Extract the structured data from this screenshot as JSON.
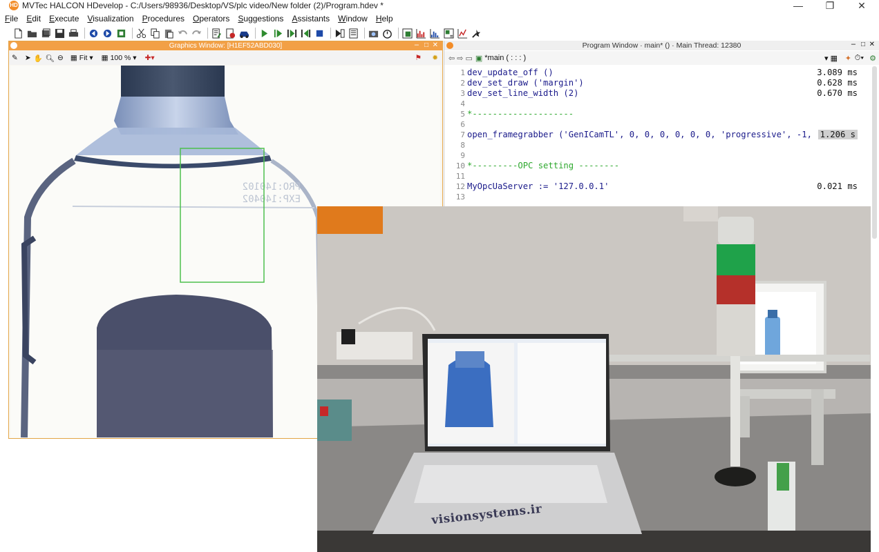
{
  "app": {
    "icon_text": "HD",
    "title": "MVTec HALCON HDevelop - C:/Users/98936/Desktop/VS/plc video/New folder (2)/Program.hdev *"
  },
  "window_controls": [
    "—",
    "❐",
    "✕"
  ],
  "menu": [
    {
      "u": "F",
      "rest": "ile"
    },
    {
      "u": "E",
      "rest": "dit"
    },
    {
      "u": "E",
      "rest": "xecute"
    },
    {
      "u": "V",
      "rest": "isualization"
    },
    {
      "u": "P",
      "rest": "rocedures"
    },
    {
      "u": "O",
      "rest": "perators"
    },
    {
      "u": "S",
      "rest": "uggestions"
    },
    {
      "u": "A",
      "rest": "ssistants"
    },
    {
      "u": "W",
      "rest": "indow"
    },
    {
      "u": "H",
      "rest": "elp"
    }
  ],
  "toolbar": {
    "icons": [
      "new-file-icon",
      "open-icon",
      "open-multiple-icon",
      "save-icon",
      "print-icon",
      "back-icon",
      "forward-icon",
      "export-icon",
      "cut-icon",
      "copy-icon",
      "paste-icon",
      "undo-icon",
      "redo-icon",
      "edit-icon",
      "stop-icon",
      "car-icon",
      "run-icon",
      "step-icon",
      "step-over-icon",
      "step-back-icon",
      "stop-square-icon",
      "run-to-icon",
      "list-icon",
      "camera-icon",
      "timer-icon",
      "zoom-window-icon",
      "histogram-icon",
      "line-profile-icon",
      "region-info-icon",
      "feature-histogram-icon",
      "inspect-icon"
    ]
  },
  "graphics_window": {
    "title": "Graphics Window: [H1EF52ABD030]",
    "zoom_fit": "Fit",
    "zoom_percent": "100 %"
  },
  "program_window": {
    "title": "Program Window · main* () · Main Thread: 12380",
    "procedure": "*main ( : : : )",
    "lines": [
      {
        "n": "1",
        "code": "dev_update_off ()",
        "time": "3.089 ms",
        "type": "code"
      },
      {
        "n": "2",
        "code": "dev_set_draw ('margin')",
        "time": "0.628 ms",
        "type": "code"
      },
      {
        "n": "3",
        "code": "dev_set_line_width (2)",
        "time": "0.670 ms",
        "type": "code"
      },
      {
        "n": "4",
        "code": "",
        "time": "",
        "type": "code"
      },
      {
        "n": "5",
        "code": "*--------------------",
        "time": "",
        "type": "comment"
      },
      {
        "n": "6",
        "code": "",
        "time": "",
        "type": "code"
      },
      {
        "n": "7",
        "code": "open_framegrabber ('GenICamTL', 0, 0, 0, 0, 0, 0, 'progressive', -1,",
        "time": "1.206 s",
        "type": "code"
      },
      {
        "n": "8",
        "code": "",
        "time": "",
        "type": "code"
      },
      {
        "n": "9",
        "code": "",
        "time": "",
        "type": "code"
      },
      {
        "n": "10",
        "code": "*---------OPC setting --------",
        "time": "",
        "type": "comment"
      },
      {
        "n": "11",
        "code": "",
        "time": "",
        "type": "code"
      },
      {
        "n": "12",
        "code": "MyOpcUaServer := '127.0.0.1'",
        "time": "0.021 ms",
        "type": "code"
      },
      {
        "n": "13",
        "code": "",
        "time": "",
        "type": "code"
      }
    ]
  },
  "photo": {
    "watermark": "visionsystems.ir"
  }
}
